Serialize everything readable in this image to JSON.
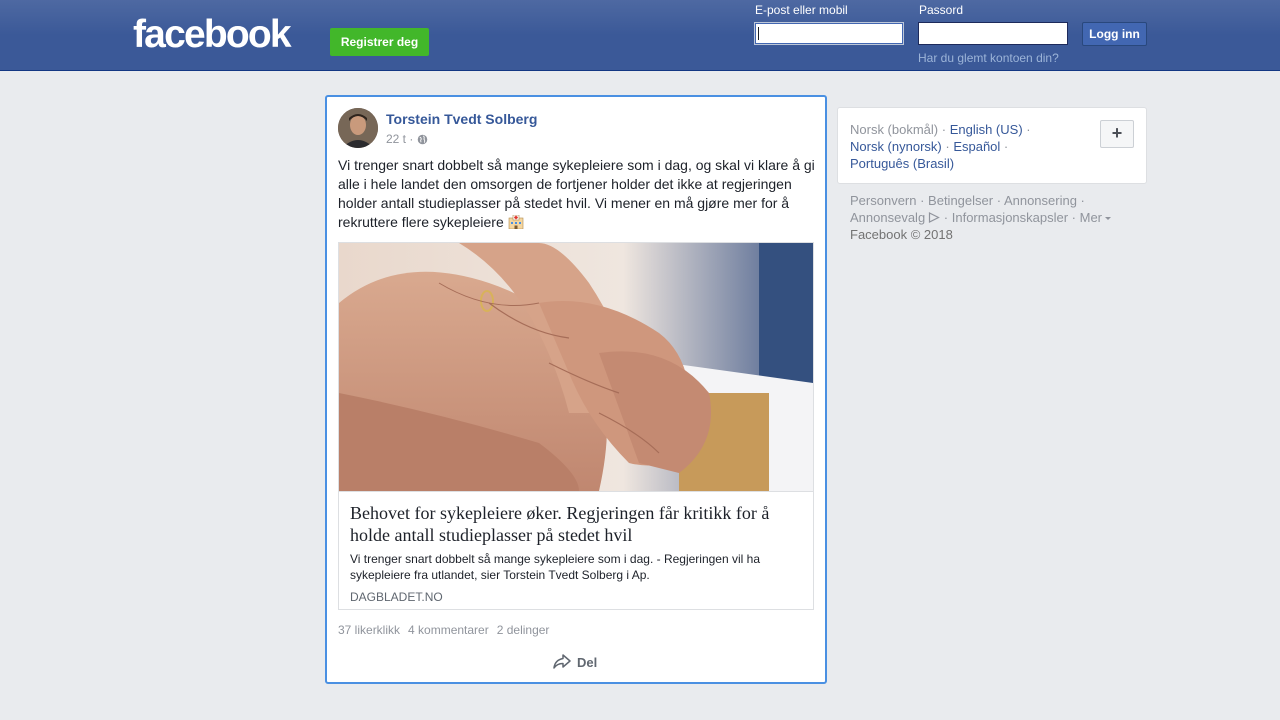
{
  "header": {
    "logo": "facebook",
    "register_label": "Registrer deg",
    "email_label": "E-post eller mobil",
    "password_label": "Passord",
    "email_value": "",
    "password_value": "",
    "login_label": "Logg inn",
    "forgot_label": "Har du glemt kontoen din?"
  },
  "post": {
    "author": "Torstein Tvedt Solberg",
    "time": "22 t ·",
    "audience_icon": "globe-icon",
    "text": "Vi trenger snart dobbelt så mange sykepleiere som i dag, og skal vi klare å gi alle i hele landet den omsorgen de fortjener holder det ikke at regjeringen holder antall studieplasser på stedet hvil. Vi mener en må gjøre mer for å rekruttere flere sykepleiere",
    "text_emoji": "hospital-emoji",
    "link": {
      "title": "Behovet for sykepleiere øker. Regjeringen får kritikk for å holde antall studieplasser på stedet hvil",
      "description": "Vi trenger snart dobbelt så mange sykepleiere som i dag. - Regjeringen vil ha sykepleiere fra utlandet, sier Torstein Tvedt Solberg i Ap.",
      "domain": "DAGBLADET.NO"
    },
    "stats": {
      "likes": "37 likerklikk",
      "comments": "4 kommentarer",
      "shares": "2 delinger"
    },
    "share_label": "Del"
  },
  "sidebar": {
    "current_language": "Norsk (bokmål)",
    "languages": [
      "English (US)",
      "Norsk (nynorsk)",
      "Español",
      "Português (Brasil)"
    ],
    "add_language_label": "+",
    "footer": {
      "privacy": "Personvern",
      "terms": "Betingelser",
      "advertising": "Annonsering",
      "ad_choices": "Annonsevalg",
      "cookies": "Informasjonskapsler",
      "more": "Mer",
      "copyright": "Facebook © 2018"
    }
  },
  "colors": {
    "brand_blue": "#3b5998",
    "register_green": "#42b72a",
    "link_blue": "#365899",
    "post_focus_border": "#4a90e2"
  }
}
